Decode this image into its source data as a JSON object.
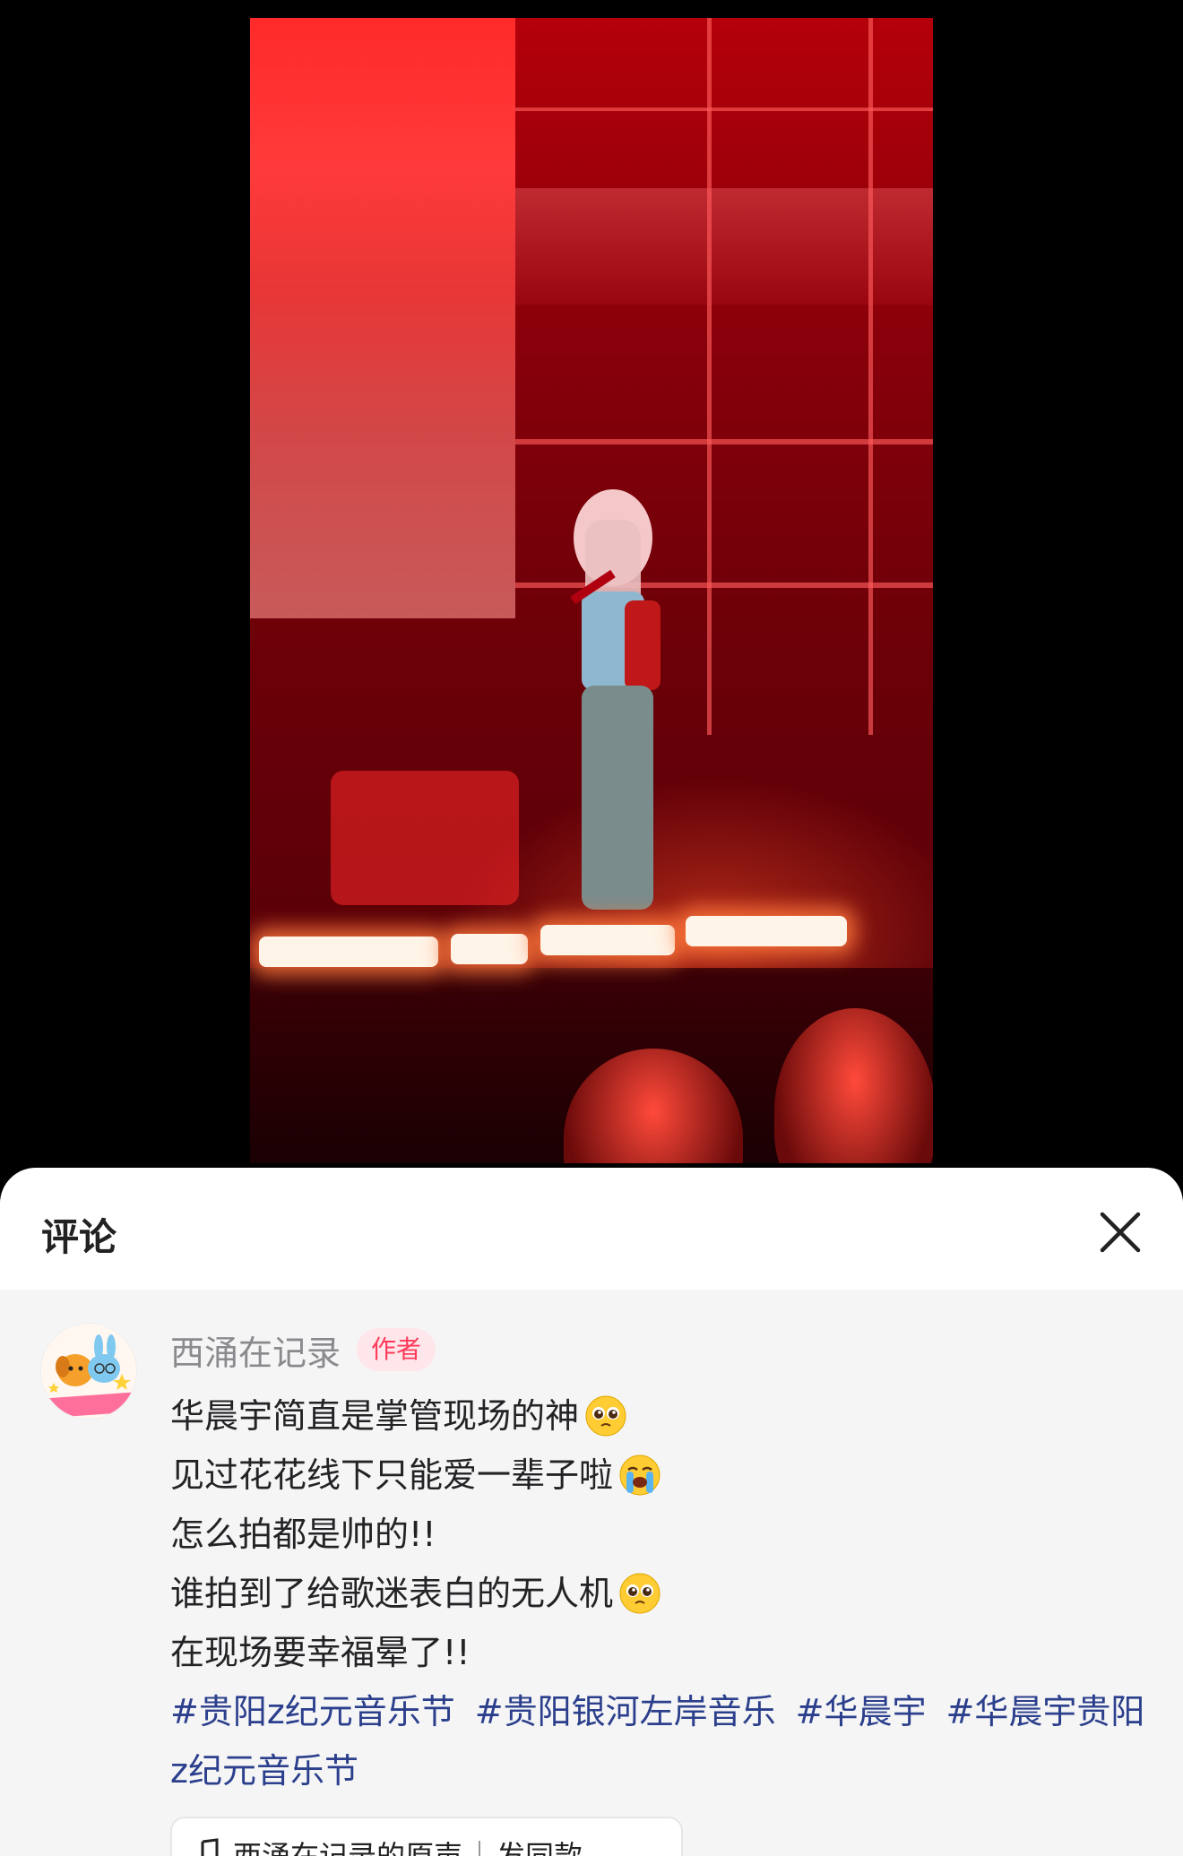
{
  "sheet": {
    "title": "评论"
  },
  "comment": {
    "author": "西涌在记录",
    "badge": "作者",
    "lines": [
      {
        "text": "华晨宇简直是掌管现场的神",
        "emoji": "pleading-face-emoji"
      },
      {
        "text": "见过花花线下只能爱一辈子啦",
        "emoji": "loudly-crying-face-emoji"
      },
      {
        "text": "怎么拍都是帅的!!",
        "emoji": ""
      },
      {
        "text": "谁拍到了给歌迷表白的无人机",
        "emoji": "pleading-face-emoji"
      },
      {
        "text": "在现场要幸福晕了!!",
        "emoji": ""
      }
    ],
    "hashtags": [
      "#贵阳z纪元音乐节",
      "#贵阳银河左岸音乐",
      "#华晨宇",
      "#华晨宇贵阳z纪元音乐节"
    ]
  },
  "sound": {
    "label": "西涌在记录的原声",
    "action": "发同款"
  },
  "colors": {
    "sheet_bg": "#f5f5f6",
    "badge_text": "#ff3a5a",
    "hashtag": "#2b3f8c",
    "video_red": "#b4000a"
  }
}
